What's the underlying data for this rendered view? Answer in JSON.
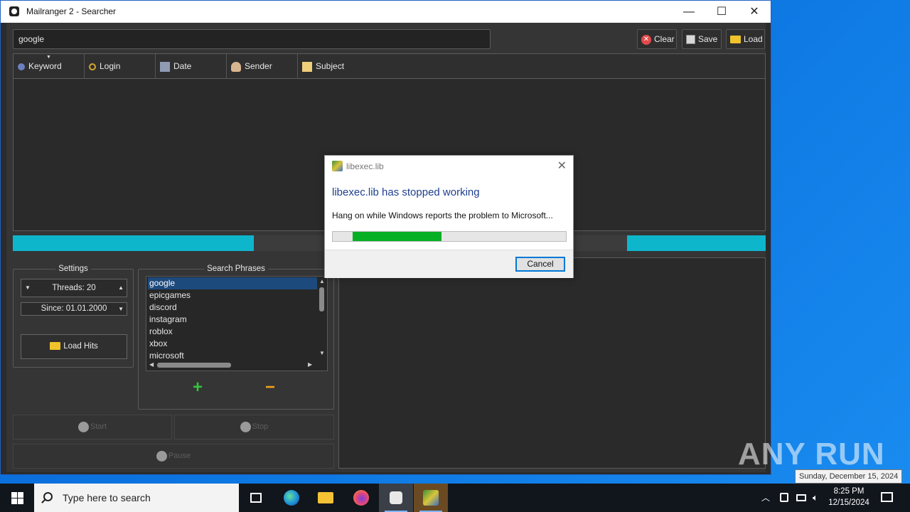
{
  "window": {
    "title": "Mailranger 2 - Searcher",
    "minimize": "—",
    "maximize": "☐",
    "close": "✕"
  },
  "toolbar": {
    "search_value": "google",
    "clear_label": "Clear",
    "save_label": "Save",
    "load_label": "Load"
  },
  "results": {
    "columns": [
      "Keyword",
      "Login",
      "Date",
      "Sender",
      "Subject"
    ],
    "sort_indicator": "▼"
  },
  "progress": {
    "segments": [
      {
        "start": 0.0,
        "end": 0.32
      },
      {
        "start": 0.816,
        "end": 1.0
      }
    ]
  },
  "settings": {
    "title": "Settings",
    "threads_label": "Threads: 20",
    "since_label": "Since: 01.01.2000",
    "load_hits_label": "Load Hits"
  },
  "search_phrases": {
    "title": "Search Phrases",
    "items": [
      "google",
      "epicgames",
      "discord",
      "instagram",
      "roblox",
      "xbox",
      "microsoft"
    ],
    "selected": "google",
    "add_symbol": "+",
    "remove_symbol": "−"
  },
  "actions": {
    "start_label": "Start",
    "stop_label": "Stop",
    "pause_label": "Pause"
  },
  "dialog": {
    "title": "libexec.lib",
    "heading": "libexec.lib has stopped working",
    "message": "Hang on while Windows reports the problem to Microsoft...",
    "progress": 0.38,
    "cancel_label": "Cancel",
    "close": "✕"
  },
  "desktop": {
    "watermark": "ANY RUN",
    "tooltip": "Sunday, December 15, 2024"
  },
  "taskbar": {
    "search_placeholder": "Type here to search",
    "time": "8:25 PM",
    "date": "12/15/2024",
    "tray_chevron": "︿"
  },
  "colors": {
    "progress_cyan": "#0eb6cc",
    "dialog_green": "#06b025",
    "dialog_heading": "#1e3f8f",
    "taskbar": "#11151c"
  }
}
